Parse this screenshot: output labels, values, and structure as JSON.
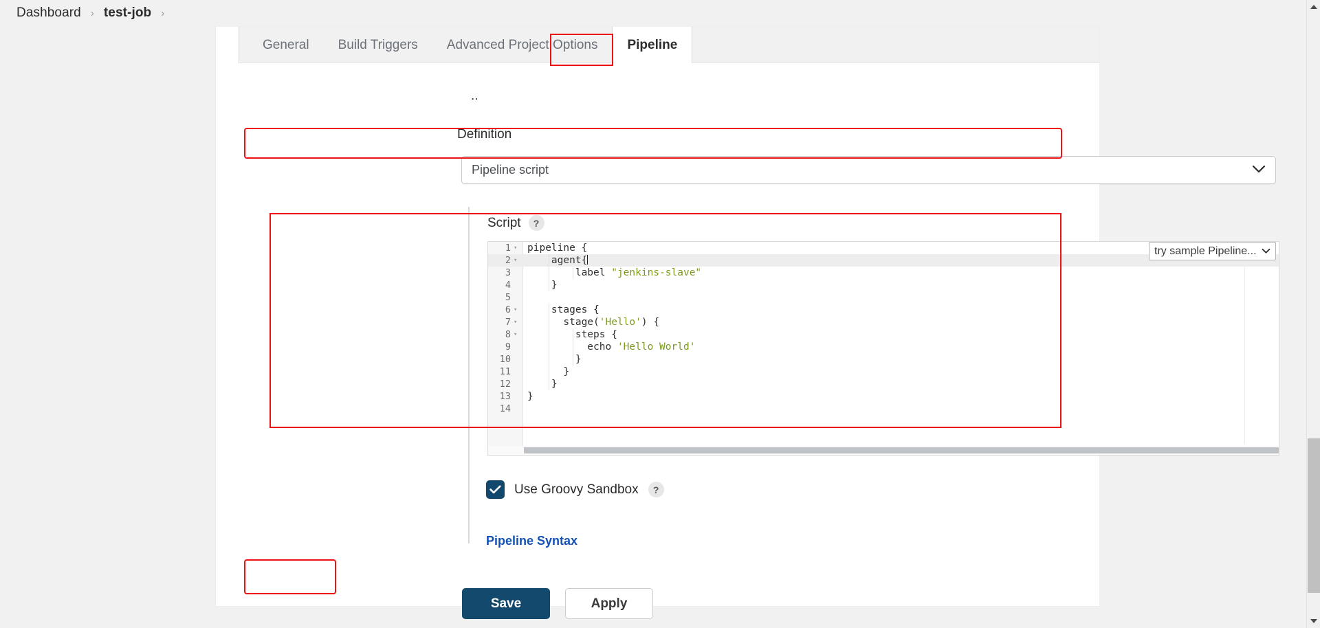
{
  "breadcrumb": {
    "items": [
      {
        "label": "Dashboard",
        "bold": false
      },
      {
        "label": "test-job",
        "bold": true
      }
    ],
    "separator": "›"
  },
  "tabs": [
    {
      "label": "General",
      "active": false
    },
    {
      "label": "Build Triggers",
      "active": false
    },
    {
      "label": "Advanced Project Options",
      "active": false
    },
    {
      "label": "Pipeline",
      "active": true
    }
  ],
  "clipped_fragment": "..",
  "definition": {
    "label": "Definition",
    "selected": "Pipeline script",
    "chevron_icon": "chevron-down-icon"
  },
  "script": {
    "label": "Script",
    "help_icon": "?",
    "sample_select": {
      "selected": "try sample Pipeline...",
      "chevron_icon": "chevron-down-icon"
    },
    "lines": [
      {
        "n": "1",
        "fold": true,
        "code": "pipeline {"
      },
      {
        "n": "2",
        "fold": true,
        "code": "    agent{",
        "active": true,
        "caret": true
      },
      {
        "n": "3",
        "fold": false,
        "code": "        label \"jenkins-slave\""
      },
      {
        "n": "4",
        "fold": false,
        "code": "    }"
      },
      {
        "n": "5",
        "fold": false,
        "code": ""
      },
      {
        "n": "6",
        "fold": true,
        "code": "    stages {"
      },
      {
        "n": "7",
        "fold": true,
        "code": "      stage('Hello') {"
      },
      {
        "n": "8",
        "fold": true,
        "code": "        steps {"
      },
      {
        "n": "9",
        "fold": false,
        "code": "          echo 'Hello World'"
      },
      {
        "n": "10",
        "fold": false,
        "code": "        }"
      },
      {
        "n": "11",
        "fold": false,
        "code": "      }"
      },
      {
        "n": "12",
        "fold": false,
        "code": "    }"
      },
      {
        "n": "13",
        "fold": false,
        "code": "}"
      },
      {
        "n": "14",
        "fold": false,
        "code": ""
      }
    ],
    "full_text": "pipeline {\n    agent{\n        label \"jenkins-slave\"\n    }\n\n    stages {\n      stage('Hello') {\n        steps {\n          echo 'Hello World'\n        }\n      }\n    }\n}\n"
  },
  "sandbox": {
    "label": "Use Groovy Sandbox",
    "checked": true,
    "help_icon": "?"
  },
  "syntax_link": "Pipeline Syntax",
  "actions": {
    "save": "Save",
    "apply": "Apply"
  },
  "colors": {
    "annotation_red": "#ee1111",
    "primary_navy": "#11486b",
    "link_blue": "#1351b4",
    "string_green": "#7c9b1e"
  }
}
